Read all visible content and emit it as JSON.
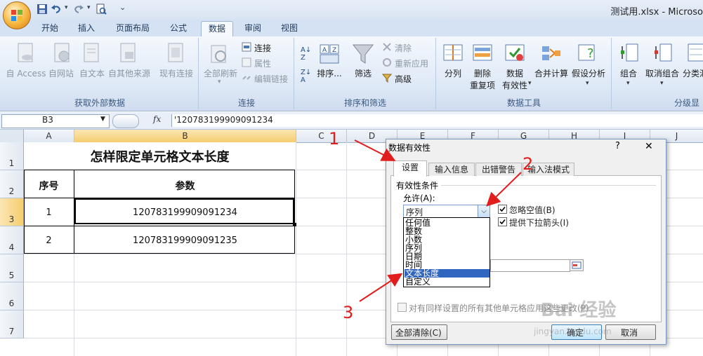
{
  "window": {
    "title": "测试用.xlsx - Microso"
  },
  "ribbon": {
    "tabs": [
      "开始",
      "插入",
      "页面布局",
      "公式",
      "数据",
      "审阅",
      "视图"
    ],
    "active_tab": "数据",
    "groups": {
      "external": {
        "label": "获取外部数据",
        "buttons": [
          "自 Access",
          "自网站",
          "自文本",
          "自其他来源",
          "现有连接"
        ]
      },
      "connections": {
        "label": "连接",
        "refresh": "全部刷新",
        "items": [
          "连接",
          "属性",
          "编辑链接"
        ]
      },
      "sort": {
        "label": "排序和筛选",
        "sort": "排序...",
        "filter": "筛选",
        "clear": "清除",
        "reapply": "重新应用",
        "advanced": "高级"
      },
      "datatools": {
        "label": "数据工具",
        "split": "分列",
        "dedup1": "删除",
        "dedup2": "重复项",
        "valid1": "数据",
        "valid2": "有效性",
        "consolidate": "合并计算",
        "whatif": "假设分析"
      },
      "outline": {
        "label": "分级显",
        "group": "组合",
        "ungroup": "取消组合",
        "subtotal": "分类汇"
      }
    }
  },
  "formula_bar": {
    "name_box": "B3",
    "fx": "fx",
    "content": "'120783199909091234"
  },
  "sheet": {
    "columns": [
      "A",
      "B",
      "C",
      "D",
      "E",
      "F",
      "G",
      "H",
      "I",
      "J"
    ],
    "rows": [
      "1",
      "2",
      "3",
      "4",
      "5",
      "6",
      "7"
    ],
    "title": "怎样限定单元格文本长度",
    "header": {
      "a": "序号",
      "b": "参数"
    },
    "data": [
      {
        "a": "1",
        "b": "120783199909091234"
      },
      {
        "a": "2",
        "b": "120783199909091235"
      }
    ]
  },
  "dialog": {
    "title": "数据有效性",
    "help": "?",
    "close": "✕",
    "tabs": [
      "设置",
      "输入信息",
      "出错警告",
      "输入法模式"
    ],
    "section": "有效性条件",
    "allow_label": "允许(A):",
    "allow_value": "序列",
    "ignore_blank": "忽略空值(B)",
    "dropdown_arrow": "提供下拉箭头(I)",
    "options": [
      "任何值",
      "整数",
      "小数",
      "序列",
      "日期",
      "时间",
      "文本长度",
      "自定义"
    ],
    "highlighted_option": "文本长度",
    "apply_all": "对有同样设置的所有其他单元格应用这些更改(P)",
    "clear_all": "全部清除(C)",
    "ok": "确定",
    "cancel": "取消"
  },
  "annotations": {
    "n1": "1",
    "n2": "2",
    "n3": "3",
    "color": "#e21d1d"
  },
  "watermark": {
    "text": "Bai 经验",
    "url": "jingyan.baidu.com"
  }
}
